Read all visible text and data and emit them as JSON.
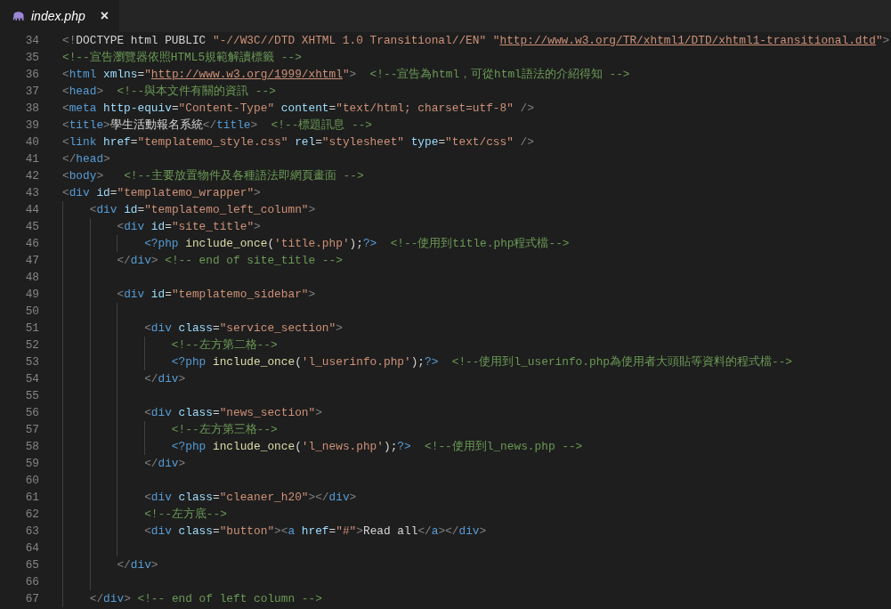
{
  "tab": {
    "title": "index.php",
    "close": "×"
  },
  "lines": [
    {
      "number": "34",
      "tokens": [
        {
          "kind": "punct",
          "text": "<!"
        },
        {
          "kind": "text",
          "text": "DOCTYPE html PUBLIC "
        },
        {
          "kind": "string",
          "text": "\"-//W3C//DTD XHTML 1.0 Transitional//EN\" \""
        },
        {
          "kind": "link",
          "text": "http://www.w3.org/TR/xhtml1/DTD/xhtml1-transitional.dtd"
        },
        {
          "kind": "string",
          "text": "\""
        },
        {
          "kind": "punct",
          "text": ">"
        }
      ]
    },
    {
      "number": "35",
      "tokens": [
        {
          "kind": "comment",
          "text": "<!--宣告瀏覽器依照HTML5規範解讀標籤 -->"
        }
      ]
    },
    {
      "number": "36",
      "tokens": [
        {
          "kind": "punct",
          "text": "<"
        },
        {
          "kind": "tag",
          "text": "html"
        },
        {
          "kind": "attr",
          "text": " xmlns"
        },
        {
          "kind": "text",
          "text": "="
        },
        {
          "kind": "string",
          "text": "\""
        },
        {
          "kind": "link",
          "text": "http://www.w3.org/1999/xhtml"
        },
        {
          "kind": "string",
          "text": "\""
        },
        {
          "kind": "punct",
          "text": ">"
        },
        {
          "kind": "comment",
          "text": "  <!--宣告為html，可從html語法的介紹得知 -->"
        }
      ]
    },
    {
      "number": "37",
      "tokens": [
        {
          "kind": "punct",
          "text": "<"
        },
        {
          "kind": "tag",
          "text": "head"
        },
        {
          "kind": "punct",
          "text": ">"
        },
        {
          "kind": "comment",
          "text": "  <!--與本文件有關的資訊 -->"
        }
      ]
    },
    {
      "number": "38",
      "tokens": [
        {
          "kind": "punct",
          "text": "<"
        },
        {
          "kind": "tag",
          "text": "meta"
        },
        {
          "kind": "attr",
          "text": " http-equiv"
        },
        {
          "kind": "text",
          "text": "="
        },
        {
          "kind": "string",
          "text": "\"Content-Type\""
        },
        {
          "kind": "attr",
          "text": " content"
        },
        {
          "kind": "text",
          "text": "="
        },
        {
          "kind": "string",
          "text": "\"text/html; charset=utf-8\""
        },
        {
          "kind": "punct",
          "text": " />"
        }
      ]
    },
    {
      "number": "39",
      "tokens": [
        {
          "kind": "punct",
          "text": "<"
        },
        {
          "kind": "tag",
          "text": "title"
        },
        {
          "kind": "punct",
          "text": ">"
        },
        {
          "kind": "text",
          "text": "學生活動報名系統"
        },
        {
          "kind": "punct",
          "text": "</"
        },
        {
          "kind": "tag",
          "text": "title"
        },
        {
          "kind": "punct",
          "text": ">"
        },
        {
          "kind": "comment",
          "text": "  <!--標題訊息 -->"
        }
      ]
    },
    {
      "number": "40",
      "tokens": [
        {
          "kind": "punct",
          "text": "<"
        },
        {
          "kind": "tag",
          "text": "link"
        },
        {
          "kind": "attr",
          "text": " href"
        },
        {
          "kind": "text",
          "text": "="
        },
        {
          "kind": "string",
          "text": "\"templatemo_style.css\""
        },
        {
          "kind": "attr",
          "text": " rel"
        },
        {
          "kind": "text",
          "text": "="
        },
        {
          "kind": "string",
          "text": "\"stylesheet\""
        },
        {
          "kind": "attr",
          "text": " type"
        },
        {
          "kind": "text",
          "text": "="
        },
        {
          "kind": "string",
          "text": "\"text/css\""
        },
        {
          "kind": "punct",
          "text": " />"
        }
      ]
    },
    {
      "number": "41",
      "tokens": [
        {
          "kind": "punct",
          "text": "</"
        },
        {
          "kind": "tag",
          "text": "head"
        },
        {
          "kind": "punct",
          "text": ">"
        }
      ]
    },
    {
      "number": "42",
      "tokens": [
        {
          "kind": "punct",
          "text": "<"
        },
        {
          "kind": "tag",
          "text": "body"
        },
        {
          "kind": "punct",
          "text": ">"
        },
        {
          "kind": "comment",
          "text": "   <!--主要放置物件及各種語法即網頁畫面 -->"
        }
      ]
    },
    {
      "number": "43",
      "tokens": [
        {
          "kind": "punct",
          "text": "<"
        },
        {
          "kind": "tag",
          "text": "div"
        },
        {
          "kind": "attr",
          "text": " id"
        },
        {
          "kind": "text",
          "text": "="
        },
        {
          "kind": "string",
          "text": "\"templatemo_wrapper\""
        },
        {
          "kind": "punct",
          "text": ">"
        }
      ]
    },
    {
      "number": "44",
      "tokens": [
        {
          "kind": "punct",
          "text": "    <"
        },
        {
          "kind": "tag",
          "text": "div"
        },
        {
          "kind": "attr",
          "text": " id"
        },
        {
          "kind": "text",
          "text": "="
        },
        {
          "kind": "string",
          "text": "\"templatemo_left_column\""
        },
        {
          "kind": "punct",
          "text": ">"
        }
      ]
    },
    {
      "number": "45",
      "tokens": [
        {
          "kind": "punct",
          "text": "        <"
        },
        {
          "kind": "tag",
          "text": "div"
        },
        {
          "kind": "attr",
          "text": " id"
        },
        {
          "kind": "text",
          "text": "="
        },
        {
          "kind": "string",
          "text": "\"site_title\""
        },
        {
          "kind": "punct",
          "text": ">"
        }
      ]
    },
    {
      "number": "46",
      "tokens": [
        {
          "kind": "php",
          "text": "            <?php"
        },
        {
          "kind": "func",
          "text": " include_once"
        },
        {
          "kind": "text",
          "text": "("
        },
        {
          "kind": "string",
          "text": "'title.php'"
        },
        {
          "kind": "text",
          "text": ");"
        },
        {
          "kind": "php",
          "text": "?>"
        },
        {
          "kind": "comment",
          "text": "  <!--使用到title.php程式檔-->"
        }
      ]
    },
    {
      "number": "47",
      "tokens": [
        {
          "kind": "punct",
          "text": "        </"
        },
        {
          "kind": "tag",
          "text": "div"
        },
        {
          "kind": "punct",
          "text": ">"
        },
        {
          "kind": "comment",
          "text": " <!-- end of site_title -->"
        }
      ]
    },
    {
      "number": "48"
    },
    {
      "number": "49",
      "tokens": [
        {
          "kind": "punct",
          "text": "        <"
        },
        {
          "kind": "tag",
          "text": "div"
        },
        {
          "kind": "attr",
          "text": " id"
        },
        {
          "kind": "text",
          "text": "="
        },
        {
          "kind": "string",
          "text": "\"templatemo_sidebar\""
        },
        {
          "kind": "punct",
          "text": ">"
        }
      ]
    },
    {
      "number": "50"
    },
    {
      "number": "51",
      "tokens": [
        {
          "kind": "punct",
          "text": "            <"
        },
        {
          "kind": "tag",
          "text": "div"
        },
        {
          "kind": "attr",
          "text": " class"
        },
        {
          "kind": "text",
          "text": "="
        },
        {
          "kind": "string",
          "text": "\"service_section\""
        },
        {
          "kind": "punct",
          "text": ">"
        }
      ]
    },
    {
      "number": "52",
      "tokens": [
        {
          "kind": "comment",
          "text": "                <!--左方第二格-->"
        }
      ]
    },
    {
      "number": "53",
      "tokens": [
        {
          "kind": "php",
          "text": "                <?php"
        },
        {
          "kind": "func",
          "text": " include_once"
        },
        {
          "kind": "text",
          "text": "("
        },
        {
          "kind": "string",
          "text": "'l_userinfo.php'"
        },
        {
          "kind": "text",
          "text": ");"
        },
        {
          "kind": "php",
          "text": "?>"
        },
        {
          "kind": "comment",
          "text": "  <!--使用到l_userinfo.php為使用者大頭貼等資料的程式檔-->"
        }
      ]
    },
    {
      "number": "54",
      "tokens": [
        {
          "kind": "punct",
          "text": "            </"
        },
        {
          "kind": "tag",
          "text": "div"
        },
        {
          "kind": "punct",
          "text": ">"
        }
      ]
    },
    {
      "number": "55"
    },
    {
      "number": "56",
      "tokens": [
        {
          "kind": "punct",
          "text": "            <"
        },
        {
          "kind": "tag",
          "text": "div"
        },
        {
          "kind": "attr",
          "text": " class"
        },
        {
          "kind": "text",
          "text": "="
        },
        {
          "kind": "string",
          "text": "\"news_section\""
        },
        {
          "kind": "punct",
          "text": ">"
        }
      ]
    },
    {
      "number": "57",
      "tokens": [
        {
          "kind": "comment",
          "text": "                <!--左方第三格-->"
        }
      ]
    },
    {
      "number": "58",
      "tokens": [
        {
          "kind": "php",
          "text": "                <?php"
        },
        {
          "kind": "func",
          "text": " include_once"
        },
        {
          "kind": "text",
          "text": "("
        },
        {
          "kind": "string",
          "text": "'l_news.php'"
        },
        {
          "kind": "text",
          "text": ");"
        },
        {
          "kind": "php",
          "text": "?>"
        },
        {
          "kind": "comment",
          "text": "  <!--使用到l_news.php -->"
        }
      ]
    },
    {
      "number": "59",
      "tokens": [
        {
          "kind": "punct",
          "text": "            </"
        },
        {
          "kind": "tag",
          "text": "div"
        },
        {
          "kind": "punct",
          "text": ">"
        }
      ]
    },
    {
      "number": "60"
    },
    {
      "number": "61",
      "tokens": [
        {
          "kind": "punct",
          "text": "            <"
        },
        {
          "kind": "tag",
          "text": "div"
        },
        {
          "kind": "attr",
          "text": " class"
        },
        {
          "kind": "text",
          "text": "="
        },
        {
          "kind": "string",
          "text": "\"cleaner_h20\""
        },
        {
          "kind": "punct",
          "text": "></"
        },
        {
          "kind": "tag",
          "text": "div"
        },
        {
          "kind": "punct",
          "text": ">"
        }
      ]
    },
    {
      "number": "62",
      "tokens": [
        {
          "kind": "comment",
          "text": "            <!--左方底-->"
        }
      ]
    },
    {
      "number": "63",
      "tokens": [
        {
          "kind": "punct",
          "text": "            <"
        },
        {
          "kind": "tag",
          "text": "div"
        },
        {
          "kind": "attr",
          "text": " class"
        },
        {
          "kind": "text",
          "text": "="
        },
        {
          "kind": "string",
          "text": "\"button\""
        },
        {
          "kind": "punct",
          "text": "><"
        },
        {
          "kind": "tag",
          "text": "a"
        },
        {
          "kind": "attr",
          "text": " href"
        },
        {
          "kind": "text",
          "text": "="
        },
        {
          "kind": "string",
          "text": "\"#\""
        },
        {
          "kind": "punct",
          "text": ">"
        },
        {
          "kind": "text",
          "text": "Read all"
        },
        {
          "kind": "punct",
          "text": "</"
        },
        {
          "kind": "tag",
          "text": "a"
        },
        {
          "kind": "punct",
          "text": "></"
        },
        {
          "kind": "tag",
          "text": "div"
        },
        {
          "kind": "punct",
          "text": ">"
        }
      ]
    },
    {
      "number": "64"
    },
    {
      "number": "65",
      "tokens": [
        {
          "kind": "punct",
          "text": "        </"
        },
        {
          "kind": "tag",
          "text": "div"
        },
        {
          "kind": "punct",
          "text": ">"
        }
      ]
    },
    {
      "number": "66"
    },
    {
      "number": "67",
      "tokens": [
        {
          "kind": "punct",
          "text": "    </"
        },
        {
          "kind": "tag",
          "text": "div"
        },
        {
          "kind": "punct",
          "text": ">"
        },
        {
          "kind": "comment",
          "text": " <!-- end of left column -->"
        }
      ]
    }
  ]
}
